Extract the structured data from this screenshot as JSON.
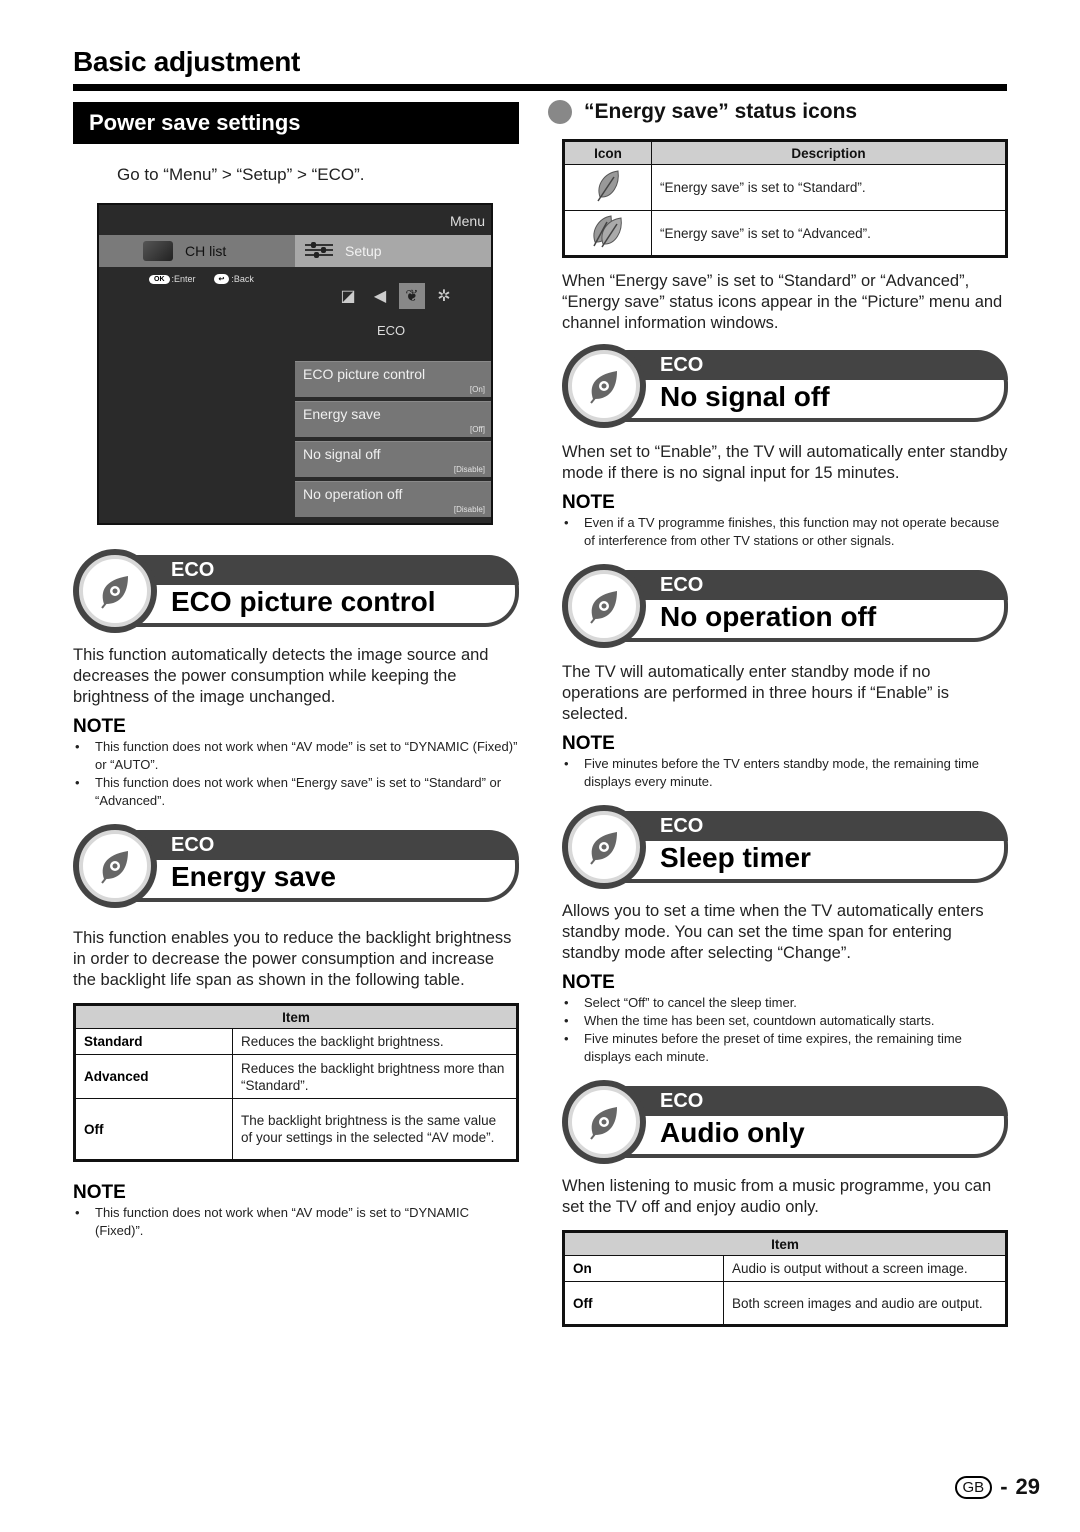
{
  "page": {
    "title": "Basic adjustment",
    "footer": {
      "region_badge": "GB",
      "separator": "-",
      "page_number": "29"
    }
  },
  "left": {
    "section_title": "Power save settings",
    "navigation_hint": "Go to “Menu” > “Setup” > “ECO”.",
    "tv_menu": {
      "menu_label": "Menu",
      "tabs": [
        {
          "label": "CH list",
          "icon": "ch-list-icon",
          "selected": false
        },
        {
          "label": "Setup",
          "icon": "setup-sliders-icon",
          "selected": true
        }
      ],
      "hints": [
        {
          "button": "OK",
          "label": ":Enter"
        },
        {
          "button": "↩",
          "label": ":Back"
        }
      ],
      "sub_icons": [
        "picture-adjust-icon",
        "audio-adjust-icon",
        "eco-leaf-icon",
        "settings-gear-icon"
      ],
      "sub_selected_label": "ECO",
      "items": [
        {
          "label": "ECO picture control",
          "value": "[On]"
        },
        {
          "label": "Energy save",
          "value": "[Off]"
        },
        {
          "label": "No signal off",
          "value": "[Disable]"
        },
        {
          "label": "No operation off",
          "value": "[Disable]"
        }
      ]
    },
    "eco_picture": {
      "tag": "ECO",
      "title": "ECO picture control",
      "body": "This function automatically detects the image source and decreases the power consumption while keeping the brightness of the image unchanged.",
      "note_title": "NOTE",
      "notes": [
        "This function does not work when “AV mode” is set to “DYNAMIC (Fixed)” or “AUTO”.",
        "This function does not work when “Energy save” is set to “Standard” or “Advanced”."
      ]
    },
    "energy_save": {
      "tag": "ECO",
      "title": "Energy save",
      "body": "This function enables you to reduce the backlight brightness in order to decrease the power consumption and increase the backlight life span as shown in the following table.",
      "table": {
        "header": "Item",
        "rows": [
          {
            "item": "Standard",
            "description": "Reduces the backlight brightness."
          },
          {
            "item": "Advanced",
            "description": "Reduces the backlight brightness more than “Standard”."
          },
          {
            "item": "Off",
            "description": "The backlight brightness is the same value of your settings in the selected “AV mode”."
          }
        ]
      },
      "note_title": "NOTE",
      "notes": [
        "This function does not work when “AV mode” is set to “DYNAMIC (Fixed)”."
      ]
    }
  },
  "right": {
    "status_icons": {
      "heading": "“Energy save” status icons",
      "table": {
        "headers": [
          "Icon",
          "Description"
        ],
        "rows": [
          {
            "icon": "single-leaf-icon",
            "description": "“Energy save” is set to “Standard”."
          },
          {
            "icon": "double-leaf-icon",
            "description": "“Energy save” is set to “Advanced”."
          }
        ]
      },
      "body": "When “Energy save” is set to “Standard” or “Advanced”, “Energy save” status icons appear in the “Picture” menu and channel information windows."
    },
    "no_signal_off": {
      "tag": "ECO",
      "title": "No signal off",
      "body": "When set to “Enable”, the TV will automatically enter standby mode if there is no signal input for 15 minutes.",
      "note_title": "NOTE",
      "notes": [
        "Even if a TV programme finishes, this function may not operate because of interference from other TV stations or other signals."
      ]
    },
    "no_operation_off": {
      "tag": "ECO",
      "title": "No operation off",
      "body": "The TV will automatically enter standby mode if no operations are performed in three hours if “Enable” is selected.",
      "note_title": "NOTE",
      "notes": [
        "Five minutes before the TV enters standby mode, the remaining time displays every minute."
      ]
    },
    "sleep_timer": {
      "tag": "ECO",
      "title": "Sleep timer",
      "body": "Allows you to set a time when the TV automatically enters standby mode. You can set the time span for entering standby mode after selecting “Change”.",
      "note_title": "NOTE",
      "notes": [
        "Select “Off” to cancel the sleep timer.",
        "When the time has been set, countdown automatically starts.",
        "Five minutes before the preset of time expires, the remaining time displays each minute."
      ]
    },
    "audio_only": {
      "tag": "ECO",
      "title": "Audio only",
      "body": "When listening to music from a music programme, you can set the TV off and enjoy audio only.",
      "table": {
        "header": "Item",
        "rows": [
          {
            "item": "On",
            "description": "Audio is output without a screen image."
          },
          {
            "item": "Off",
            "description": "Both screen images and audio are output."
          }
        ]
      }
    }
  }
}
